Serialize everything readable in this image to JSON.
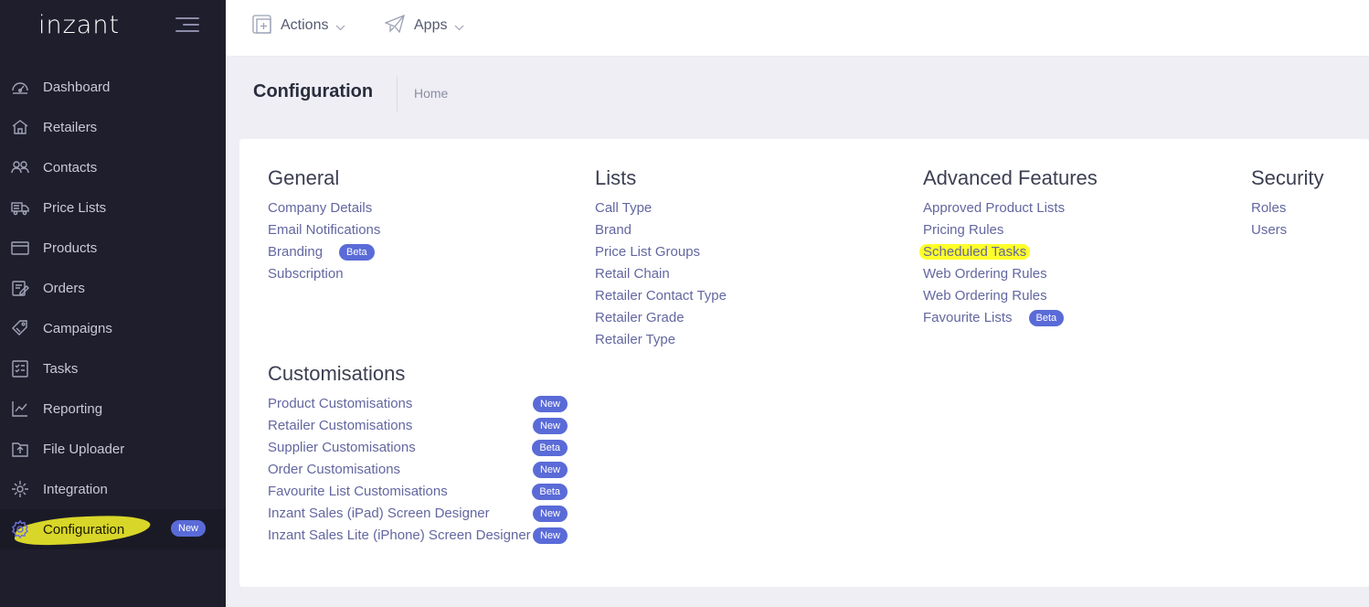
{
  "sidebar": {
    "brand": "inzant",
    "items": [
      {
        "label": "Dashboard",
        "icon": "dashboard-icon"
      },
      {
        "label": "Retailers",
        "icon": "home-icon"
      },
      {
        "label": "Contacts",
        "icon": "users-icon"
      },
      {
        "label": "Price Lists",
        "icon": "truck-icon"
      },
      {
        "label": "Products",
        "icon": "box-icon"
      },
      {
        "label": "Orders",
        "icon": "edit-icon"
      },
      {
        "label": "Campaigns",
        "icon": "tag-icon"
      },
      {
        "label": "Tasks",
        "icon": "checklist-icon"
      },
      {
        "label": "Reporting",
        "icon": "chart-icon"
      },
      {
        "label": "File Uploader",
        "icon": "upload-icon"
      },
      {
        "label": "Integration",
        "icon": "integration-icon"
      },
      {
        "label": "Configuration",
        "icon": "gear-icon",
        "badge": "New",
        "active": true
      }
    ]
  },
  "topbar": {
    "actions_label": "Actions",
    "apps_label": "Apps"
  },
  "subheader": {
    "title": "Configuration",
    "breadcrumb": "Home"
  },
  "sections": {
    "general": {
      "title": "General",
      "links": [
        {
          "label": "Company Details"
        },
        {
          "label": "Email Notifications"
        },
        {
          "label": "Branding",
          "badge": "Beta"
        },
        {
          "label": "Subscription"
        }
      ]
    },
    "lists": {
      "title": "Lists",
      "links": [
        {
          "label": "Call Type"
        },
        {
          "label": "Brand"
        },
        {
          "label": "Price List Groups"
        },
        {
          "label": "Retail Chain"
        },
        {
          "label": "Retailer Contact Type"
        },
        {
          "label": "Retailer Grade"
        },
        {
          "label": "Retailer Type"
        }
      ]
    },
    "advanced": {
      "title": "Advanced Features",
      "links": [
        {
          "label": "Approved Product Lists"
        },
        {
          "label": "Pricing Rules"
        },
        {
          "label": "Scheduled Tasks",
          "highlighted": true
        },
        {
          "label": "Web Ordering Rules"
        },
        {
          "label": "Web Ordering Rules"
        },
        {
          "label": "Favourite Lists",
          "badge": "Beta"
        }
      ]
    },
    "security": {
      "title": "Security",
      "links": [
        {
          "label": "Roles"
        },
        {
          "label": "Users"
        }
      ]
    },
    "customisations": {
      "title": "Customisations",
      "links": [
        {
          "label": "Product Customisations",
          "badge": "New"
        },
        {
          "label": "Retailer Customisations",
          "badge": "New"
        },
        {
          "label": "Supplier Customisations",
          "badge": "Beta"
        },
        {
          "label": "Order Customisations",
          "badge": "New"
        },
        {
          "label": "Favourite List Customisations",
          "badge": "Beta"
        },
        {
          "label": "Inzant Sales (iPad) Screen Designer",
          "badge": "New"
        },
        {
          "label": "Inzant Sales Lite (iPhone) Screen Designer",
          "badge": "New"
        }
      ]
    }
  },
  "colors": {
    "sidebar_bg": "#1e1e2d",
    "badge": "#5a6bd8",
    "link": "#6367a0",
    "highlight": "#ffff2a"
  }
}
